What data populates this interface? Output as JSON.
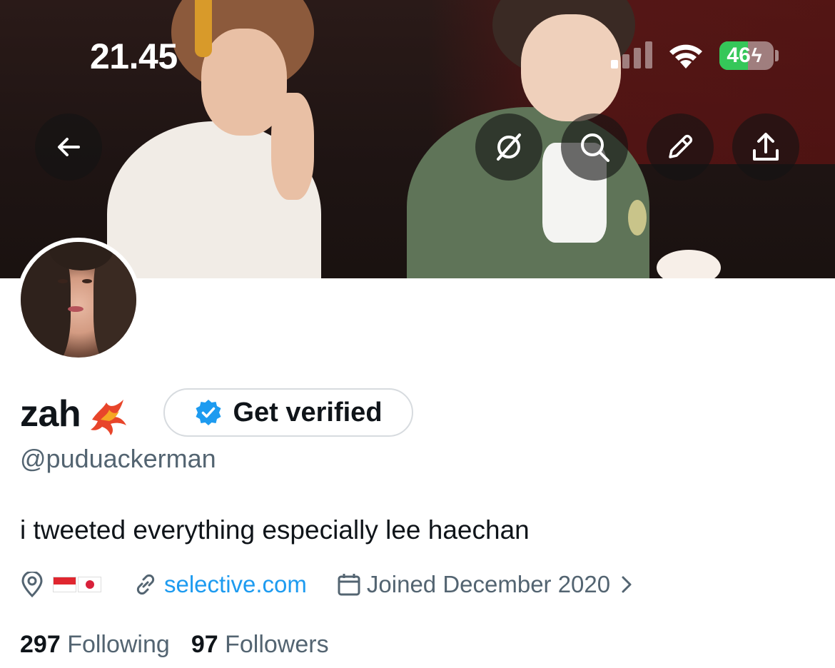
{
  "status_bar": {
    "time": "21.45",
    "battery": "46"
  },
  "header_icons": [
    "back-arrow-icon",
    "grok-icon",
    "search-icon",
    "edit-pencil-icon",
    "share-icon"
  ],
  "profile": {
    "display_name": "zah",
    "verify_label": "Get verified",
    "handle": "@puduackerman",
    "bio": "i tweeted everything especially lee haechan",
    "link": "selective.com",
    "joined": "Joined December 2020",
    "following_count": "297",
    "following_label": "Following",
    "followers_count": "97",
    "followers_label": "Followers"
  },
  "colors": {
    "accent": "#1d9bf0",
    "secondary_text": "#536471",
    "battery_green": "#35c759"
  }
}
